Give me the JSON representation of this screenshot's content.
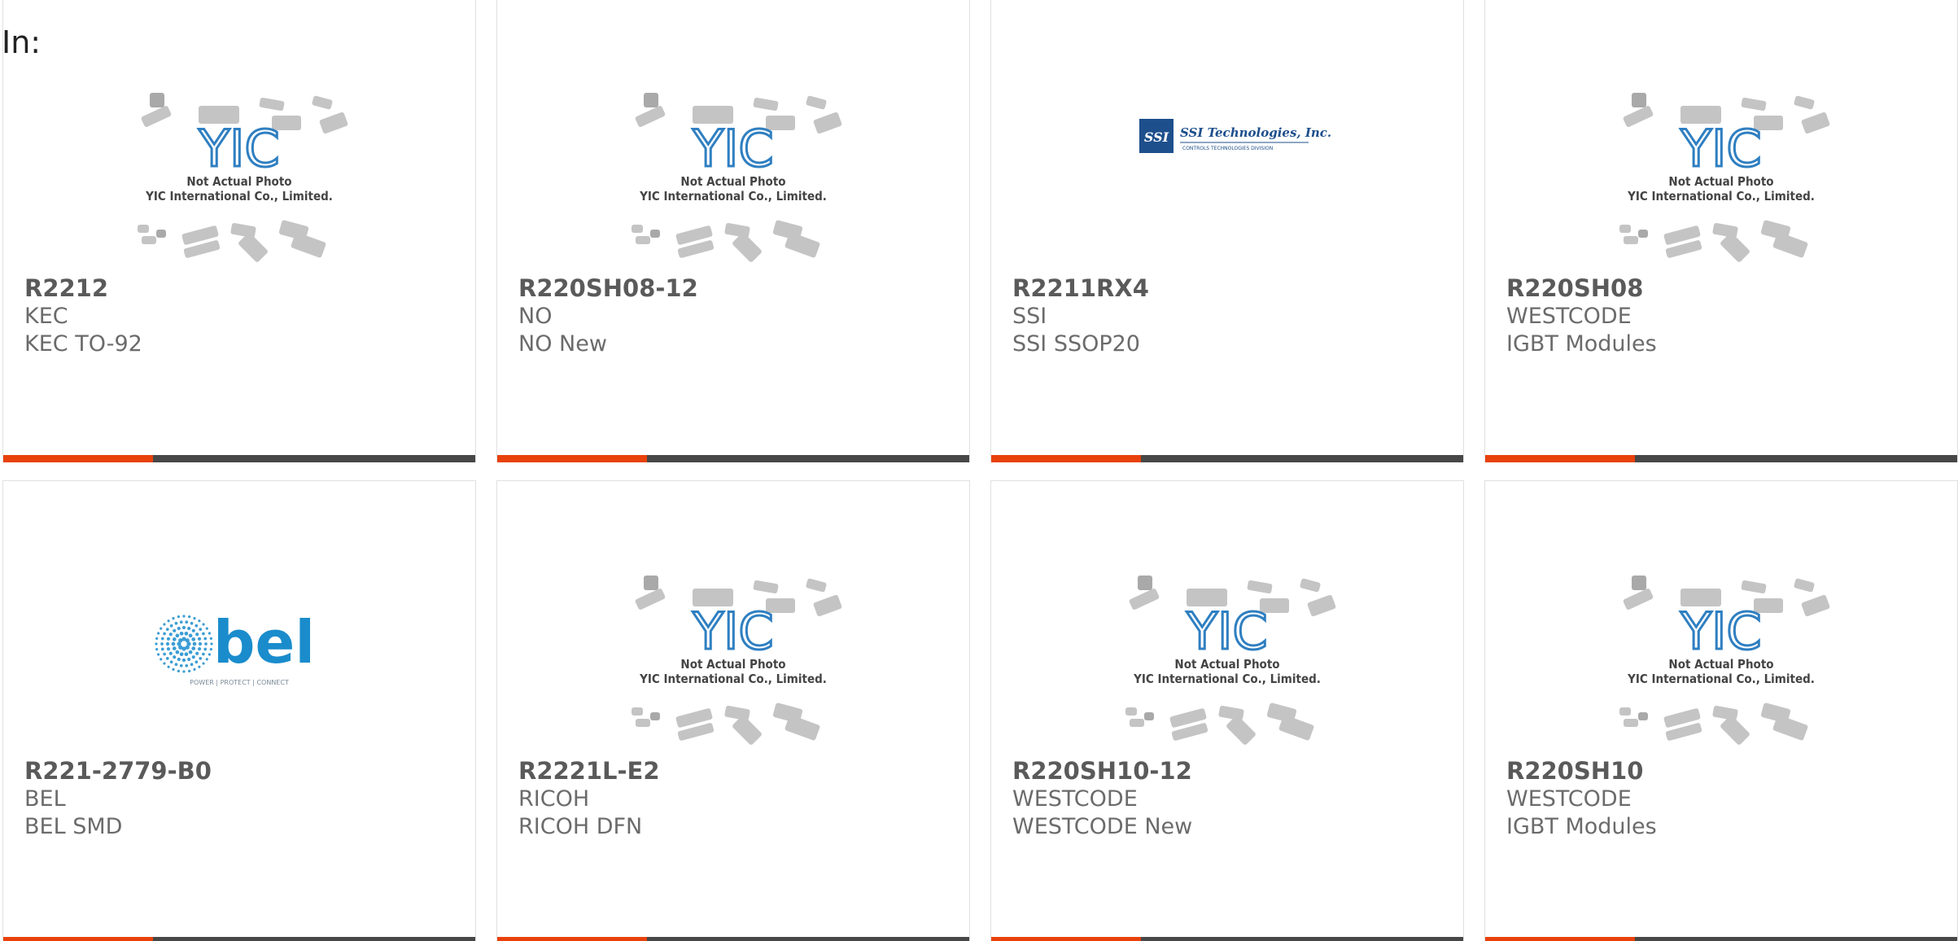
{
  "header": {
    "label": "In:"
  },
  "placeholder": {
    "brand": "YIC",
    "line1": "Not Actual Photo",
    "line2": "YIC International Co., Limited.",
    "brand_color": "#2f7fc1"
  },
  "ssi_logo": {
    "text": "SSI Technologies, Inc.",
    "subtext": "CONTROLS TECHNOLOGIES DIVISION",
    "mark": "SSI",
    "color": "#1d4f8c"
  },
  "bel_logo": {
    "text": "bel",
    "tagline": "POWER | PROTECT | CONNECT",
    "color": "#1a8ccc"
  },
  "colors": {
    "accent": "#e8410b",
    "bar": "#474747"
  },
  "products": [
    {
      "part": "R2212",
      "manufacturer": "KEC",
      "description": "KEC TO-92",
      "image": "placeholder"
    },
    {
      "part": "R220SH08-12",
      "manufacturer": "NO",
      "description": "NO New",
      "image": "placeholder"
    },
    {
      "part": "R2211RX4",
      "manufacturer": "SSI",
      "description": "SSI SSOP20",
      "image": "ssi-logo"
    },
    {
      "part": "R220SH08",
      "manufacturer": "WESTCODE",
      "description": "IGBT Modules",
      "image": "placeholder"
    },
    {
      "part": "R221-2779-B0",
      "manufacturer": "BEL",
      "description": "BEL SMD",
      "image": "bel-logo"
    },
    {
      "part": "R2221L-E2",
      "manufacturer": "RICOH",
      "description": "RICOH DFN",
      "image": "placeholder"
    },
    {
      "part": "R220SH10-12",
      "manufacturer": "WESTCODE",
      "description": "WESTCODE New",
      "image": "placeholder"
    },
    {
      "part": "R220SH10",
      "manufacturer": "WESTCODE",
      "description": "IGBT Modules",
      "image": "placeholder"
    }
  ]
}
